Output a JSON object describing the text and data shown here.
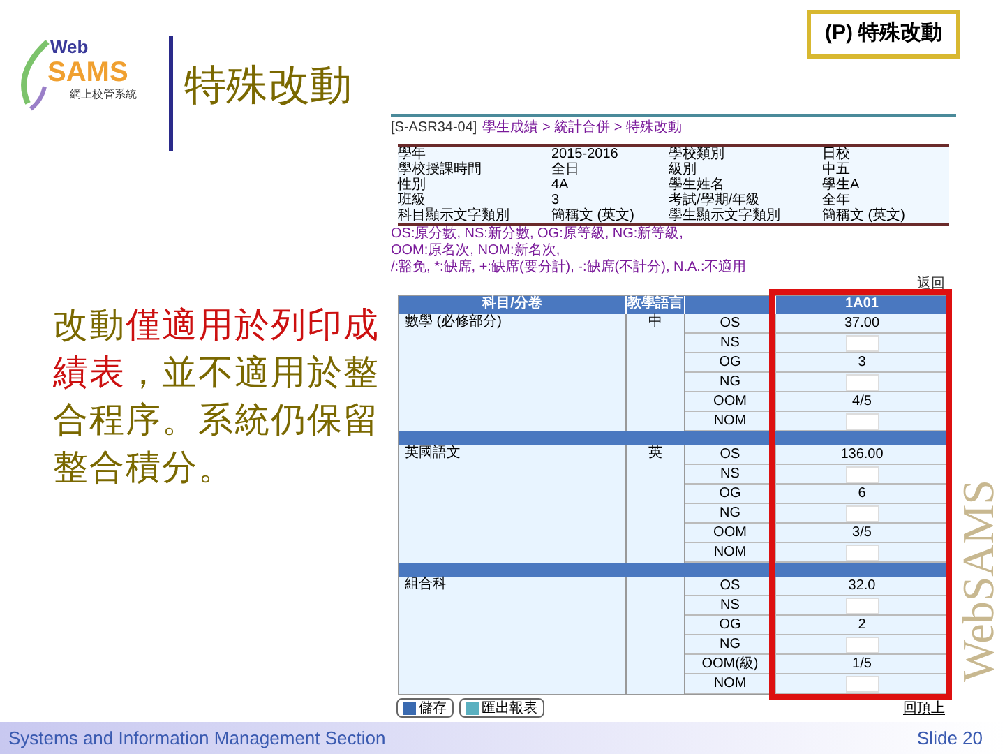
{
  "logo": {
    "line_1": "Web",
    "line_2": "SAMS",
    "line_3": "網上校管系統"
  },
  "slide_title": "特殊改動",
  "section_tag": "(P) 特殊改動",
  "note_parts": [
    {
      "text": "改動",
      "emphasis": false
    },
    {
      "text": "僅適用於列印成績表",
      "emphasis": true
    },
    {
      "text": "，並不適用於整合程序。系統仍保留整合積分。",
      "emphasis": false
    }
  ],
  "screenshot": {
    "breadcrumb": {
      "code": "[S-ASR34-04]",
      "path": "學生成績 > 統計合併 > 特殊改動"
    },
    "info_rows": [
      {
        "label_1": "學年",
        "value_1": "2015-2016",
        "label_2": "學校類別",
        "value_2": "日校"
      },
      {
        "label_1": "學校授課時間",
        "value_1": "全日",
        "label_2": "級別",
        "value_2": "中五"
      },
      {
        "label_1": "性別",
        "value_1": "4A",
        "label_2": "學生姓名",
        "value_2": "學生A"
      },
      {
        "label_1": "班級",
        "value_1": "3",
        "label_2": "考試/學期/年級",
        "value_2": "全年"
      },
      {
        "label_1": "科目顯示文字類別",
        "value_1": "簡稱文 (英文)",
        "label_2": "學生顯示文字類別",
        "value_2": "簡稱文 (英文)"
      }
    ],
    "legend_lines": [
      "OS:原分數, NS:新分數, OG:原等級, NG:新等級,",
      "OOM:原名次, NOM:新名次,",
      "/:豁免, *:缺席, +:缺席(要分計), -:缺席(不計分), N.A.:不適用"
    ],
    "top_link": "返回",
    "columns": [
      "科目/分卷",
      "教學語言",
      "1A01"
    ],
    "subjects": [
      {
        "name": "數學 (必修部分)",
        "language": "中",
        "rows": [
          {
            "code": "OS",
            "kind": "text",
            "value": "37.00"
          },
          {
            "code": "NS",
            "kind": "input"
          },
          {
            "code": "OG",
            "kind": "text",
            "value": "3"
          },
          {
            "code": "NG",
            "kind": "input"
          },
          {
            "code": "OOM",
            "kind": "text",
            "value": "4/5"
          },
          {
            "code": "NOM",
            "kind": "input"
          }
        ]
      },
      {
        "name": "英國語文",
        "language": "英",
        "rows": [
          {
            "code": "OS",
            "kind": "text",
            "value": "136.00"
          },
          {
            "code": "NS",
            "kind": "input"
          },
          {
            "code": "OG",
            "kind": "text",
            "value": "6"
          },
          {
            "code": "NG",
            "kind": "input"
          },
          {
            "code": "OOM",
            "kind": "text",
            "value": "3/5"
          },
          {
            "code": "NOM",
            "kind": "input"
          }
        ]
      },
      {
        "name": "組合科",
        "rows": [
          {
            "code": "OS",
            "kind": "text",
            "value": "32.0"
          },
          {
            "code": "NS",
            "kind": "input"
          },
          {
            "code": "OG",
            "kind": "text",
            "value": "2"
          },
          {
            "code": "NG",
            "kind": "input"
          },
          {
            "code": "OOM(級)",
            "kind": "text",
            "value": "1/5"
          },
          {
            "code": "NOM",
            "kind": "input"
          }
        ]
      }
    ],
    "buttons": [
      "儲存",
      "匯出報表"
    ],
    "bottom_link": "回頂上"
  },
  "side_brand": "WebSAMS",
  "footer": {
    "section": "Systems and Information Management Section",
    "slide": "Slide 20"
  }
}
